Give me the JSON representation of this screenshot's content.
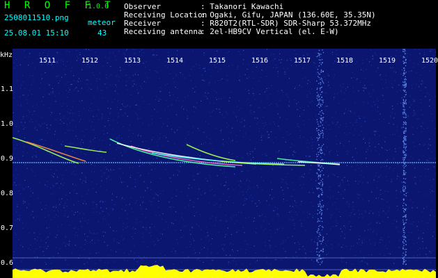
{
  "header": {
    "brand": "H R O F F T",
    "version": "1.0.0",
    "filename": "2508011510.png",
    "detection_label": "meteor",
    "datetime": "25.08.01 15:10",
    "detection_count": "43"
  },
  "meta": [
    {
      "key": "Observer",
      "value": ": Takanori Kawachi"
    },
    {
      "key": "Receiving Location",
      "value": ": Ogaki, Gifu, JAPAN (136.60E, 35.35N)"
    },
    {
      "key": "Receiver",
      "value": ": R820T2(RTL-SDR) SDR-Sharp 53.372MHz"
    },
    {
      "key": "Receiving antenna",
      "value": ": 2el-HB9CV Vertical (el. E-W)"
    }
  ],
  "axis": {
    "unit": "kHz",
    "x_ticks": [
      "1511",
      "1512",
      "1513",
      "1514",
      "1515",
      "1516",
      "1517",
      "1518",
      "1519",
      "1520"
    ],
    "y_ticks": [
      "1.1",
      "1.0",
      "0.9",
      "0.8",
      "0.7",
      "0.6"
    ]
  },
  "colors": {
    "background": "#0a1670",
    "header_text": "#00ffff",
    "brand": "#00ff00",
    "baseline_band": "#ffff00",
    "carrier_line": "#6fb7ff"
  }
}
